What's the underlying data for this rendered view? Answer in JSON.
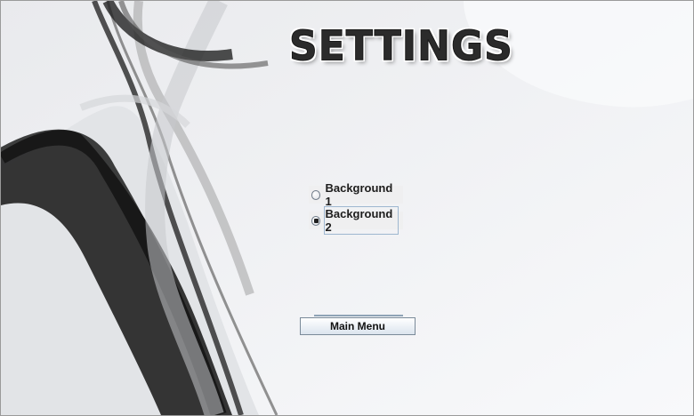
{
  "window": {
    "title_text": "SETTINGS"
  },
  "settings": {
    "background_options": [
      {
        "label": "Background 1",
        "selected": false
      },
      {
        "label": "Background 2",
        "selected": true
      }
    ]
  },
  "actions": {
    "main_menu_label": "Main Menu"
  },
  "colors": {
    "accent_dark": "#1f1f1f",
    "background_light": "#f3f4f6"
  }
}
